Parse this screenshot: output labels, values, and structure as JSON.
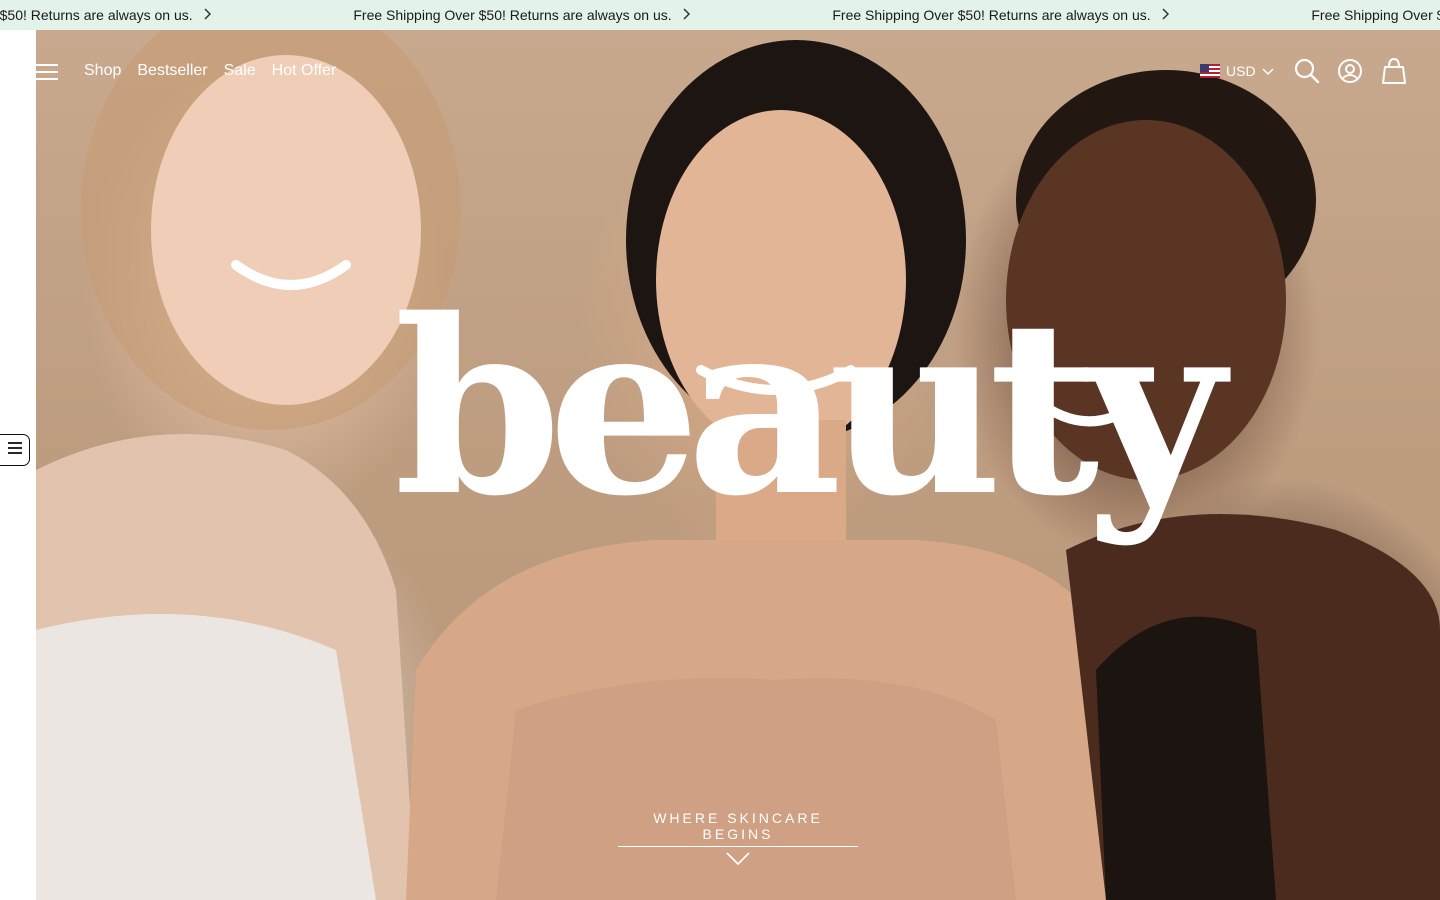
{
  "announcement": {
    "items": [
      "Free Shipping Over $50! Returns are always on us.",
      "Free Shipping Over $50! Returns are always on us.",
      "Free Shipping Over $50! Returns are always on us.",
      "Free Shipping Over $50! Returns are always on us."
    ],
    "chevron_icon": "chevron-right-icon",
    "background": "#e3f3ea"
  },
  "header": {
    "menu_icon": "hamburger-icon",
    "nav": [
      "Shop",
      "Bestseller",
      "Sale",
      "Hot Offer"
    ],
    "currency": {
      "code": "USD",
      "flag_icon": "us-flag-icon",
      "dropdown_icon": "chevron-down-icon"
    },
    "actions": [
      "search-icon",
      "account-icon",
      "cart-icon"
    ]
  },
  "hero": {
    "headline": "beauty",
    "tagline": "WHERE SKINCARE BEGINS",
    "scroll_icon": "chevron-down-icon"
  },
  "side_widget": {
    "icon": "list-icon"
  }
}
